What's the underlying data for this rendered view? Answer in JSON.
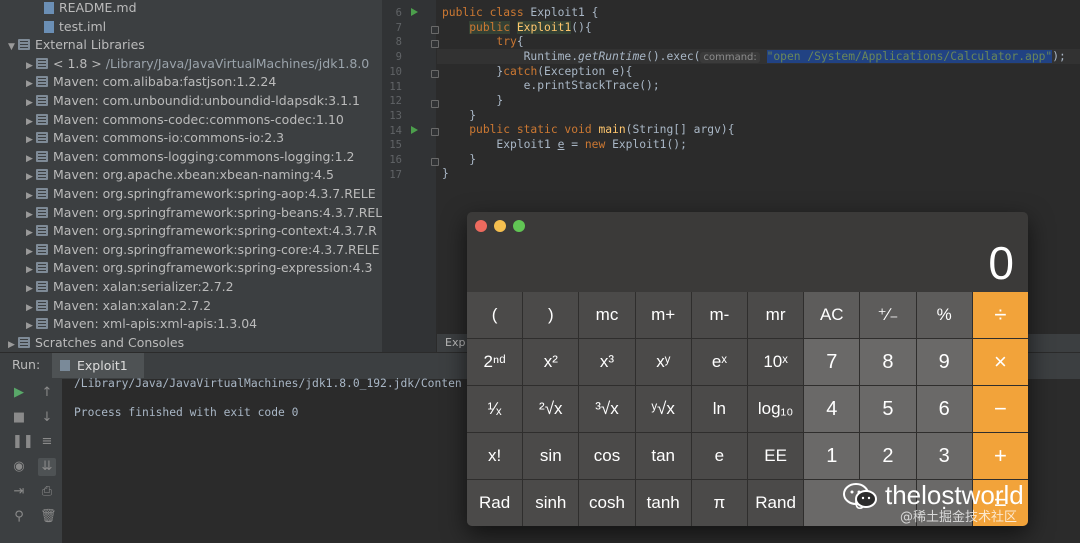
{
  "project_tree": {
    "rows": [
      {
        "indent": 2,
        "icon": "file",
        "label": "README.md",
        "extra": ""
      },
      {
        "indent": 2,
        "icon": "file",
        "label": "test.iml",
        "extra": ""
      },
      {
        "indent": 0,
        "icon": "lib",
        "label": "External Libraries",
        "extra": "",
        "expanded": true
      },
      {
        "indent": 1,
        "icon": "lib",
        "label": "< 1.8 >",
        "extra": " /Library/Java/JavaVirtualMachines/jdk1.8.0"
      },
      {
        "indent": 1,
        "icon": "lib",
        "label": "Maven: com.alibaba:fastjson:1.2.24",
        "extra": ""
      },
      {
        "indent": 1,
        "icon": "lib",
        "label": "Maven: com.unboundid:unboundid-ldapsdk:3.1.1",
        "extra": ""
      },
      {
        "indent": 1,
        "icon": "lib",
        "label": "Maven: commons-codec:commons-codec:1.10",
        "extra": ""
      },
      {
        "indent": 1,
        "icon": "lib",
        "label": "Maven: commons-io:commons-io:2.3",
        "extra": ""
      },
      {
        "indent": 1,
        "icon": "lib",
        "label": "Maven: commons-logging:commons-logging:1.2",
        "extra": ""
      },
      {
        "indent": 1,
        "icon": "lib",
        "label": "Maven: org.apache.xbean:xbean-naming:4.5",
        "extra": ""
      },
      {
        "indent": 1,
        "icon": "lib",
        "label": "Maven: org.springframework:spring-aop:4.3.7.RELE",
        "extra": ""
      },
      {
        "indent": 1,
        "icon": "lib",
        "label": "Maven: org.springframework:spring-beans:4.3.7.REL",
        "extra": ""
      },
      {
        "indent": 1,
        "icon": "lib",
        "label": "Maven: org.springframework:spring-context:4.3.7.R",
        "extra": ""
      },
      {
        "indent": 1,
        "icon": "lib",
        "label": "Maven: org.springframework:spring-core:4.3.7.RELE",
        "extra": ""
      },
      {
        "indent": 1,
        "icon": "lib",
        "label": "Maven: org.springframework:spring-expression:4.3",
        "extra": ""
      },
      {
        "indent": 1,
        "icon": "lib",
        "label": "Maven: xalan:serializer:2.7.2",
        "extra": ""
      },
      {
        "indent": 1,
        "icon": "lib",
        "label": "Maven: xalan:xalan:2.7.2",
        "extra": ""
      },
      {
        "indent": 1,
        "icon": "lib",
        "label": "Maven: xml-apis:xml-apis:1.3.04",
        "extra": ""
      },
      {
        "indent": 0,
        "icon": "lib",
        "label": "Scratches and Consoles",
        "extra": ""
      }
    ]
  },
  "editor": {
    "line_numbers": [
      "6",
      "7",
      "8",
      "9",
      "10",
      "11",
      "12",
      "13",
      "14",
      "15",
      "16",
      "17"
    ],
    "l6_a": "public class ",
    "l6_b": "Exploit1 {",
    "l7_kw": "public",
    "l7_fn": "Exploit1",
    "l7_rest": "(){",
    "l8_kw": "try",
    "l8_rest": "{",
    "l9_a": "Runtime.",
    "l9_b": "getRuntime",
    "l9_c": "().exec(",
    "l9_hint": "command:",
    "l9_str": "\"open /System/Applications/Calculator.app\"",
    "l9_end": ");",
    "l10_a": "}",
    "l10_kw": "catch",
    "l10_b": "(Exception e){",
    "l11": "e.printStackTrace();",
    "l12": "}",
    "l13": "}",
    "l14_kw": "public static void ",
    "l14_fn": "main",
    "l14_rest": "(String[] argv){",
    "l15_a": "Exploit1 ",
    "l15_b": "e",
    "l15_c": " = ",
    "l15_kw": "new ",
    "l15_d": "Exploit1();",
    "l16": "}",
    "l17": "}",
    "bottom_tab": "Exp"
  },
  "run": {
    "label": "Run:",
    "tab": "Exploit1",
    "console_line1": "/Library/Java/JavaVirtualMachines/jdk1.8.0_192.jdk/Conten",
    "console_line2": "Process finished with exit code 0"
  },
  "calculator": {
    "display": "0",
    "traffic_colors": {
      "close": "#ed6a5e",
      "minimize": "#f5bf4f",
      "zoom": "#61c554"
    },
    "accent": "#f2a33a",
    "keys": [
      {
        "label": "(",
        "kind": "sci"
      },
      {
        "label": ")",
        "kind": "sci"
      },
      {
        "label": "mc",
        "kind": "sci"
      },
      {
        "label": "m+",
        "kind": "sci"
      },
      {
        "label": "m-",
        "kind": "sci"
      },
      {
        "label": "mr",
        "kind": "sci"
      },
      {
        "label": "AC",
        "kind": "top"
      },
      {
        "label": "⁺∕₋",
        "kind": "top"
      },
      {
        "label": "%",
        "kind": "top"
      },
      {
        "label": "÷",
        "kind": "op"
      },
      {
        "label": "2ⁿᵈ",
        "kind": "sci"
      },
      {
        "label": "x²",
        "kind": "sci"
      },
      {
        "label": "x³",
        "kind": "sci"
      },
      {
        "label": "xʸ",
        "kind": "sci"
      },
      {
        "label": "eˣ",
        "kind": "sci"
      },
      {
        "label": "10ˣ",
        "kind": "sci"
      },
      {
        "label": "7",
        "kind": "num"
      },
      {
        "label": "8",
        "kind": "num"
      },
      {
        "label": "9",
        "kind": "num"
      },
      {
        "label": "×",
        "kind": "op"
      },
      {
        "label": "¹∕ₓ",
        "kind": "sci"
      },
      {
        "label": "²√x",
        "kind": "sci"
      },
      {
        "label": "³√x",
        "kind": "sci"
      },
      {
        "label": "ʸ√x",
        "kind": "sci"
      },
      {
        "label": "ln",
        "kind": "sci"
      },
      {
        "label": "log₁₀",
        "kind": "sci"
      },
      {
        "label": "4",
        "kind": "num"
      },
      {
        "label": "5",
        "kind": "num"
      },
      {
        "label": "6",
        "kind": "num"
      },
      {
        "label": "−",
        "kind": "op"
      },
      {
        "label": "x!",
        "kind": "sci"
      },
      {
        "label": "sin",
        "kind": "sci"
      },
      {
        "label": "cos",
        "kind": "sci"
      },
      {
        "label": "tan",
        "kind": "sci"
      },
      {
        "label": "e",
        "kind": "sci"
      },
      {
        "label": "EE",
        "kind": "sci"
      },
      {
        "label": "1",
        "kind": "num"
      },
      {
        "label": "2",
        "kind": "num"
      },
      {
        "label": "3",
        "kind": "num"
      },
      {
        "label": "+",
        "kind": "op"
      },
      {
        "label": "Rad",
        "kind": "sci"
      },
      {
        "label": "sinh",
        "kind": "sci"
      },
      {
        "label": "cosh",
        "kind": "sci"
      },
      {
        "label": "tanh",
        "kind": "sci"
      },
      {
        "label": "π",
        "kind": "sci"
      },
      {
        "label": "Rand",
        "kind": "sci"
      },
      {
        "label": "0",
        "kind": "num",
        "wide": true
      },
      {
        "label": ".",
        "kind": "num"
      },
      {
        "label": "=",
        "kind": "op"
      }
    ]
  },
  "watermark": {
    "name": "thelostworld",
    "sub": "@稀土掘金技术社区"
  }
}
